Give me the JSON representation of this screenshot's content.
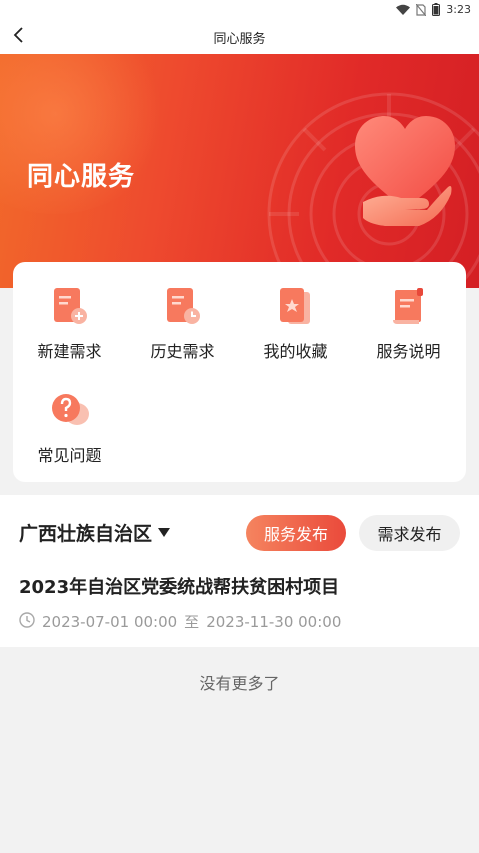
{
  "status_bar": {
    "time": "3:23",
    "icons": [
      "wifi-icon",
      "no-sim-icon",
      "battery-icon"
    ]
  },
  "header": {
    "title": "同心服务",
    "back_icon": "chevron-left-icon"
  },
  "banner": {
    "title": "同心服务",
    "icon": "heart-hand-icon"
  },
  "menu": {
    "items": [
      {
        "label": "新建需求",
        "icon": "new-demand-icon"
      },
      {
        "label": "历史需求",
        "icon": "history-demand-icon"
      },
      {
        "label": "我的收藏",
        "icon": "favorites-icon"
      },
      {
        "label": "服务说明",
        "icon": "service-info-icon"
      },
      {
        "label": "常见问题",
        "icon": "faq-icon"
      }
    ]
  },
  "region": {
    "name": "广西壮族自治区",
    "service_button": "服务发布",
    "demand_button": "需求发布"
  },
  "project": {
    "title": "2023年自治区党委统战帮扶贫困村项目",
    "start": "2023-07-01 00:00",
    "separator": "至",
    "end": "2023-11-30 00:00"
  },
  "footer": {
    "no_more": "没有更多了"
  },
  "colors": {
    "primary_red": "#e12a28",
    "accent_orange": "#f26a2a",
    "muted_text": "#9a9a9a"
  }
}
